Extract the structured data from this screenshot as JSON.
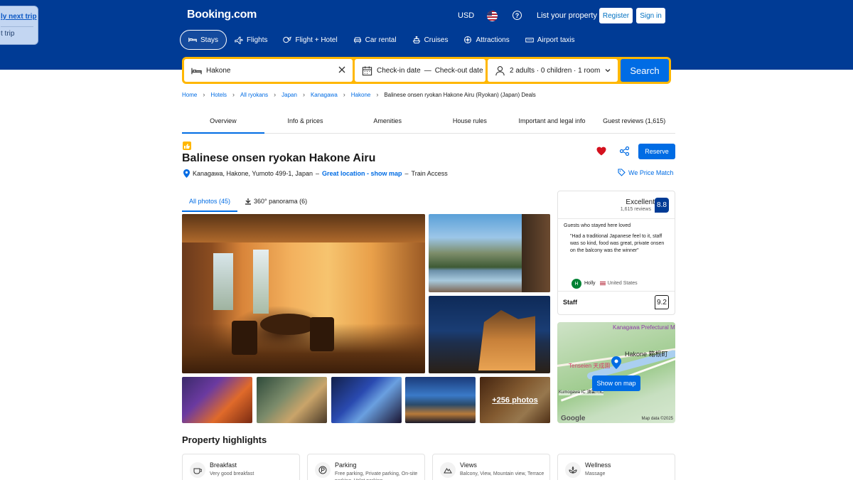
{
  "popup": {
    "line1": "ly next trip",
    "line2": "t trip"
  },
  "header": {
    "logo": "Booking.com",
    "currency": "USD",
    "help": "?",
    "list_property": "List your property",
    "register": "Register",
    "signin": "Sign in"
  },
  "nav": {
    "items": [
      {
        "label": "Stays",
        "icon": "bed-icon"
      },
      {
        "label": "Flights",
        "icon": "plane-icon"
      },
      {
        "label": "Flight + Hotel",
        "icon": "flight-hotel-icon"
      },
      {
        "label": "Car rental",
        "icon": "car-icon"
      },
      {
        "label": "Cruises",
        "icon": "ship-icon"
      },
      {
        "label": "Attractions",
        "icon": "attractions-icon"
      },
      {
        "label": "Airport taxis",
        "icon": "taxi-icon"
      }
    ]
  },
  "search": {
    "destination": "Hakone",
    "checkin": "Check-in date",
    "dash": "—",
    "checkout": "Check-out date",
    "guests": "2 adults · 0 children · 1 room",
    "button": "Search"
  },
  "breadcrumb": {
    "items": [
      "Home",
      "Hotels",
      "All ryokans",
      "Japan",
      "Kanagawa",
      "Hakone"
    ],
    "chev": "›",
    "current": "Balinese onsen ryokan Hakone Airu (Ryokan) (Japan) Deals"
  },
  "tabs": [
    "Overview",
    "Info & prices",
    "Amenities",
    "House rules",
    "Important and legal info",
    "Guest reviews (1,615)"
  ],
  "property": {
    "title": "Balinese onsen ryokan Hakone Airu",
    "address": "Kanagawa, Hakone, Yumoto 499-1, Japan",
    "sep1": "–",
    "location_link": "Great location - show map",
    "sep2": "–",
    "access": "Train Access",
    "reserve": "Reserve",
    "price_match": "We Price Match"
  },
  "photo_tabs": {
    "all": "All photos (45)",
    "panorama": "360° panorama (6)"
  },
  "photos": {
    "more": "+256 photos"
  },
  "review": {
    "word": "Excellent",
    "count": "1,615 reviews",
    "score": "8.8",
    "loved": "Guests who stayed here loved",
    "quote": "\"Had a traditional Japanese feel to it, staff was so kind, food was great, private onsen on the balcony was the winner\"",
    "initial": "H",
    "name": "Holly",
    "country": "United States",
    "staff_label": "Staff",
    "staff_score": "9.2"
  },
  "map": {
    "pref": "Kanagawa Prefectural Museum of... 神奈川県立生命の星・地球博物館",
    "hakone": "Hakone 箱根町",
    "tenseien": "Tenseien 天成園",
    "kumo": "Kumogawa IC 須雲川IC",
    "google": "Google",
    "mapdata": "Map data ©2025",
    "button": "Show on map"
  },
  "highlights": {
    "title": "Property highlights",
    "items": [
      {
        "name": "Breakfast",
        "desc": "Very good breakfast",
        "icon": "coffee-icon"
      },
      {
        "name": "Parking",
        "desc": "Free parking, Private parking, On-site parking, Valet parking",
        "icon": "parking-icon"
      },
      {
        "name": "Views",
        "desc": "Balcony, View, Mountain view, Terrace",
        "icon": "mountain-icon"
      },
      {
        "name": "Wellness",
        "desc": "Massage",
        "icon": "spa-icon"
      }
    ]
  },
  "colors": {
    "brand_blue": "#003b95",
    "accent_blue": "#006ce4",
    "search_yellow": "#ffb700",
    "heart_red": "#d4111e"
  }
}
